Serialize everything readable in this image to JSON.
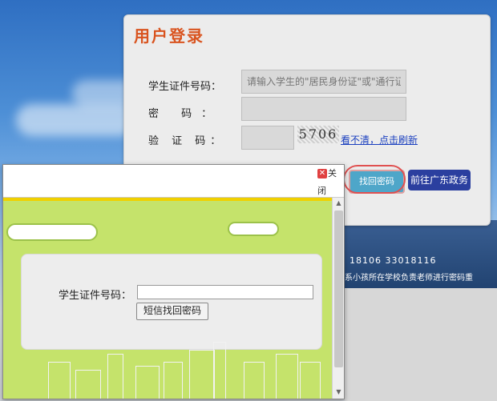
{
  "login": {
    "title": "用户登录",
    "id_label": "学生证件号码：",
    "id_placeholder": "请输入学生的\"居民身份证\"或\"通行证\"",
    "password_label": "密 码：",
    "captcha_label": "验 证 码：",
    "captcha_code": "5706",
    "refresh_link": "看不清，点击刷新",
    "find_password_button": "找回密码",
    "go_gd_button": "前往广东政务"
  },
  "background": {
    "phone_text": "18106  33018116",
    "notice_text": "系小孩所在学校负责老师进行密码重"
  },
  "popup": {
    "close_label_1": "关",
    "close_label_2": "闭",
    "form_label": "学生证件号码：",
    "sms_button": "短信找回密码"
  },
  "colors": {
    "title_red": "#d9531e",
    "popup_green": "#c5e36b",
    "button_blue": "#2b3f9f",
    "find_button": "#4ea6c9"
  },
  "icons": {
    "close": "close-icon",
    "scroll_up": "scroll-up-icon",
    "scroll_down": "scroll-down-icon"
  }
}
